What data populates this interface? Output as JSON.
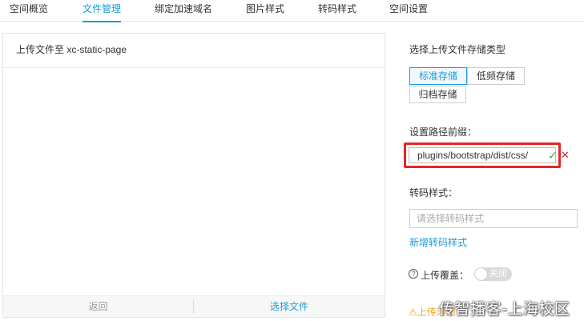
{
  "tabs": [
    {
      "label": "空间概览",
      "active": false
    },
    {
      "label": "文件管理",
      "active": true
    },
    {
      "label": "绑定加速域名",
      "active": false
    },
    {
      "label": "图片样式",
      "active": false
    },
    {
      "label": "转码样式",
      "active": false
    },
    {
      "label": "空间设置",
      "active": false
    }
  ],
  "upload": {
    "header": "上传文件至 xc-static-page",
    "back_label": "返回",
    "choose_label": "选择文件"
  },
  "storage": {
    "label": "选择上传文件存储类型",
    "options": [
      {
        "label": "标准存储",
        "selected": true
      },
      {
        "label": "低频存储",
        "selected": false
      },
      {
        "label": "归档存储",
        "selected": false
      }
    ]
  },
  "prefix": {
    "label": "设置路径前缀：",
    "value": "plugins/bootstrap/dist/css/",
    "confirm_icon": "check-icon",
    "cancel_icon": "close-icon"
  },
  "transcode": {
    "label": "转码样式：",
    "placeholder": "请选择转码样式",
    "add_link": "新增转码样式"
  },
  "overwrite": {
    "label": "上传覆盖：",
    "toggle_text": "关闭",
    "enabled": false
  },
  "notice": {
    "text": "上传须知"
  },
  "watermark": {
    "text": "传智播客-上海校区"
  },
  "colors": {
    "accent": "#1a9bd7",
    "highlight_border": "#e22727",
    "confirm": "#2ab12d",
    "warning": "#f0a020"
  }
}
